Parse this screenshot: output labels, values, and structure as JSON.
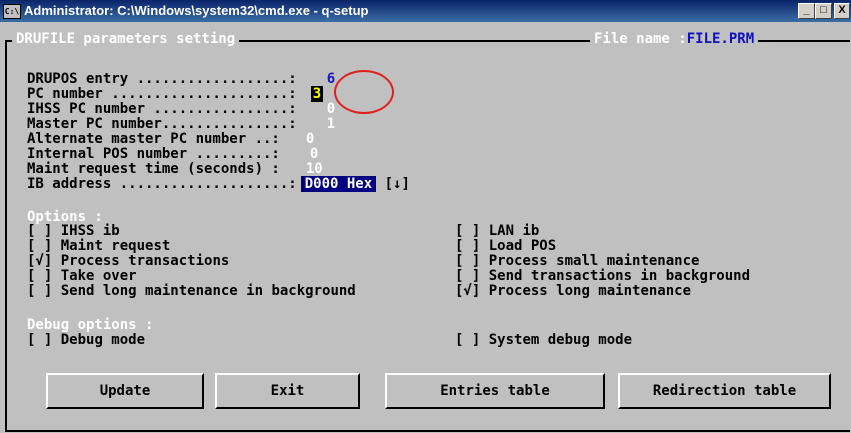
{
  "window": {
    "icon_text": "C:\\",
    "title": "Administrator: C:\\Windows\\system32\\cmd.exe - q-setup",
    "min": "_",
    "max": "□",
    "close": "X"
  },
  "panel": {
    "title": "DRUFILE parameters setting",
    "file_label": "File name :",
    "file_value": "FILE.PRM"
  },
  "fields": [
    {
      "label": "DRUPOS entry ..................:",
      "value": "6"
    },
    {
      "label": "PC number .....................:",
      "value": "3"
    },
    {
      "label": "IHSS PC number ................:",
      "value": "0"
    },
    {
      "label": "Master PC number...............:",
      "value": "1"
    },
    {
      "label": "Alternate master PC number ..:",
      "value": "0"
    },
    {
      "label": "Internal POS number .........:",
      "value": "0"
    },
    {
      "label": "Maint request time (seconds) :",
      "value": "10"
    },
    {
      "label": "IB address ....................:",
      "value": "D000 Hex",
      "suffix": "[↓]"
    }
  ],
  "options": {
    "heading": "Options :",
    "items": [
      {
        "box": "[ ]",
        "label": "IHSS ib"
      },
      {
        "box": "[ ]",
        "label": "LAN ib"
      },
      {
        "box": "[ ]",
        "label": "Maint request"
      },
      {
        "box": "[ ]",
        "label": "Load POS"
      },
      {
        "box": "[√]",
        "label": "Process transactions"
      },
      {
        "box": "[ ]",
        "label": "Process small maintenance"
      },
      {
        "box": "[ ]",
        "label": "Take over"
      },
      {
        "box": "[ ]",
        "label": "Send transactions in background"
      },
      {
        "box": "[ ]",
        "label": "Send long maintenance in background"
      },
      {
        "box": "[√]",
        "label": "Process long maintenance"
      }
    ]
  },
  "debug": {
    "heading": "Debug options :",
    "items": [
      {
        "box": "[ ]",
        "label": "Debug mode"
      },
      {
        "box": "[ ]",
        "label": "System debug mode"
      }
    ]
  },
  "buttons": {
    "update": "Update",
    "exit": "Exit",
    "entries": "Entries table",
    "redirection": "Redirection table"
  },
  "colors": {
    "title_bar": "#0a246a",
    "console_bg": "#c0c0c0",
    "value_blue": "#1414c8",
    "highlight": "#000080",
    "annotation": "#e02020"
  }
}
